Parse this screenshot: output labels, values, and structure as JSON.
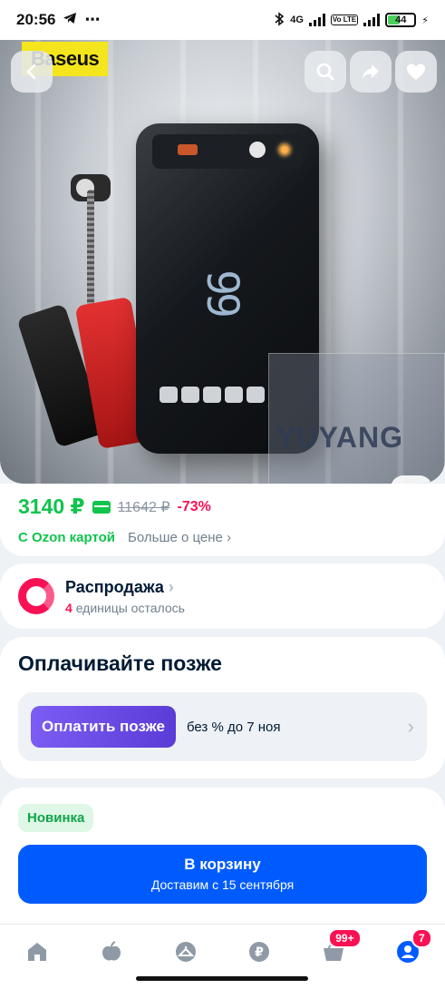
{
  "status_bar": {
    "time": "20:56",
    "network": "4G",
    "volte": "Vo LTE",
    "battery": "44"
  },
  "hero": {
    "brand": "Baseus",
    "watermark": "YUYANG",
    "device_display": "99"
  },
  "price": {
    "current": "3140 ₽",
    "old": "11642 ₽",
    "discount": "-73%",
    "card_label": "С Ozon картой",
    "more_label": "Больше о цене"
  },
  "sale": {
    "title": "Распродажа",
    "count": "4",
    "subtitle": "единицы осталось"
  },
  "pay_later": {
    "title": "Оплачивайте позже",
    "button": "Оплатить позже",
    "text": "без % до 7 ноя"
  },
  "cta": {
    "badge": "Новинка",
    "button": "В корзину",
    "delivery": "Доставим с 15 сентября"
  },
  "nav": {
    "cart_badge": "99+",
    "profile_badge": "7"
  },
  "colors": {
    "price_green": "#10c44c",
    "discount_pink": "#f91155",
    "cta_blue": "#005bff",
    "pay_purple": "#6b4ce6"
  }
}
